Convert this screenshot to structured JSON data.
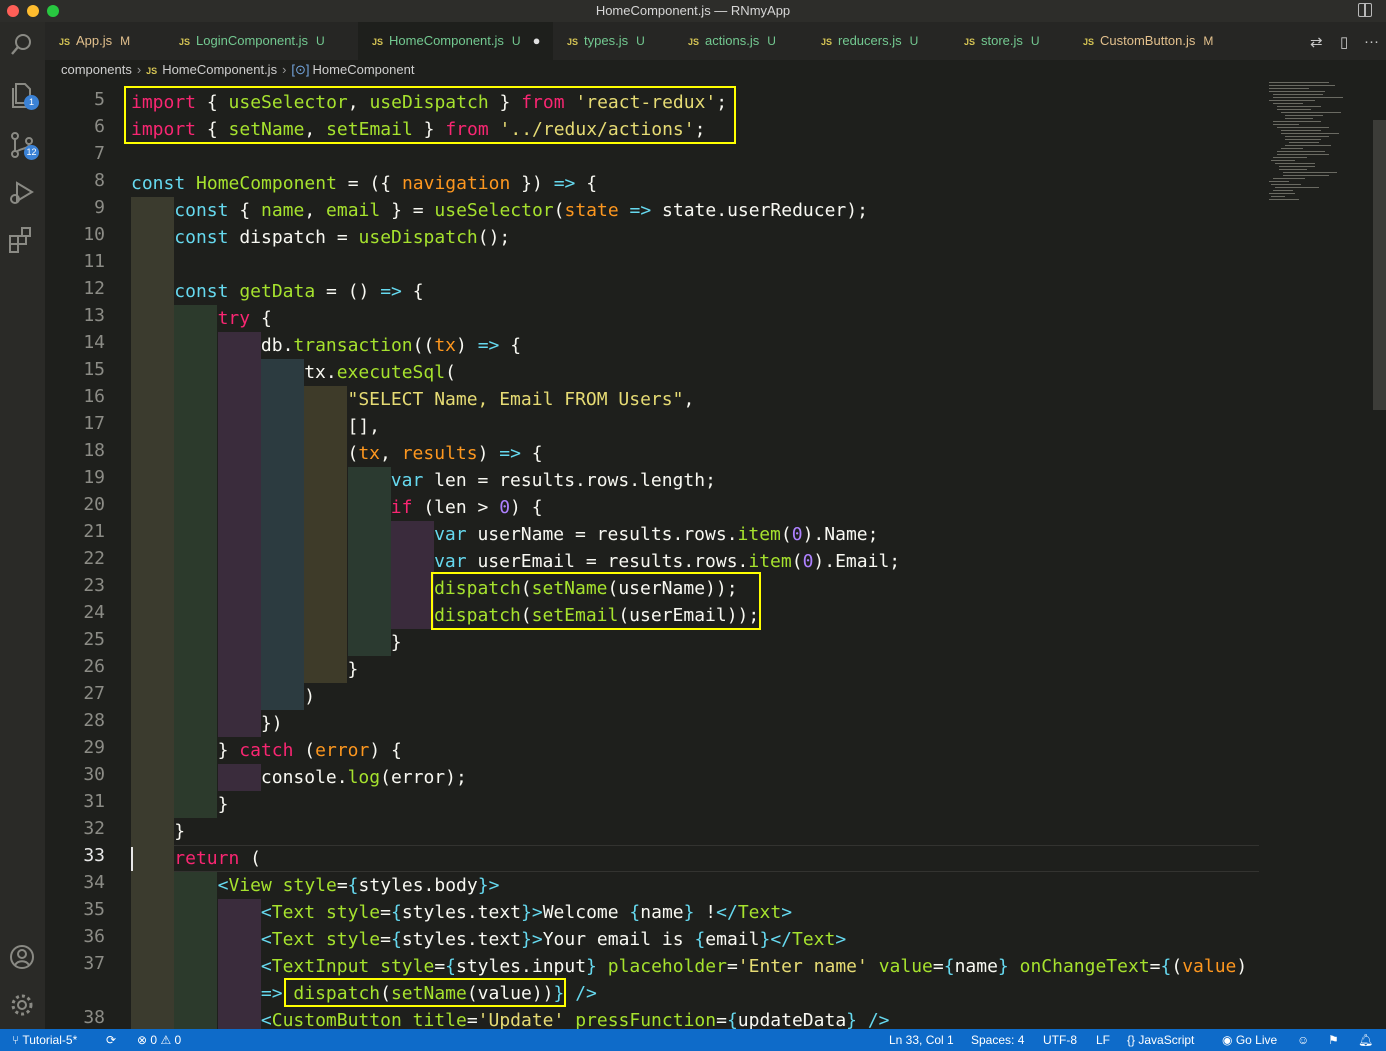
{
  "window": {
    "title": "HomeComponent.js — RNmyApp"
  },
  "activity_bar": {
    "explorer_badge": "1",
    "source_control_badge": "12"
  },
  "tabs": [
    {
      "name": "App.js",
      "status": "M",
      "status_color": "#e2c08d"
    },
    {
      "name": "LoginComponent.js",
      "status": "U",
      "status_color": "#73c991"
    },
    {
      "name": "HomeComponent.js",
      "status": "U",
      "status_color": "#73c991",
      "active": true,
      "dirty": "●"
    },
    {
      "name": "types.js",
      "status": "U",
      "status_color": "#73c991"
    },
    {
      "name": "actions.js",
      "status": "U",
      "status_color": "#73c991"
    },
    {
      "name": "reducers.js",
      "status": "U",
      "status_color": "#73c991"
    },
    {
      "name": "store.js",
      "status": "U",
      "status_color": "#73c991"
    },
    {
      "name": "CustomButton.js",
      "status": "M",
      "status_color": "#e2c08d"
    }
  ],
  "tab_labels": {
    "js": "JS",
    "more": "···"
  },
  "breadcrumb": {
    "folder": "components",
    "file": "HomeComponent.js",
    "symbol": "HomeComponent"
  },
  "editor": {
    "current_line": "33",
    "lines": [
      {
        "no": "5",
        "depth": 0
      },
      {
        "no": "6",
        "depth": 0
      },
      {
        "no": "7",
        "depth": 0
      },
      {
        "no": "8",
        "depth": 0
      },
      {
        "no": "9",
        "depth": 1
      },
      {
        "no": "10",
        "depth": 1
      },
      {
        "no": "11",
        "depth": 1
      },
      {
        "no": "12",
        "depth": 1
      },
      {
        "no": "13",
        "depth": 2
      },
      {
        "no": "14",
        "depth": 3
      },
      {
        "no": "15",
        "depth": 4
      },
      {
        "no": "16",
        "depth": 5
      },
      {
        "no": "17",
        "depth": 5
      },
      {
        "no": "18",
        "depth": 5
      },
      {
        "no": "19",
        "depth": 6
      },
      {
        "no": "20",
        "depth": 6
      },
      {
        "no": "21",
        "depth": 7
      },
      {
        "no": "22",
        "depth": 7
      },
      {
        "no": "23",
        "depth": 7
      },
      {
        "no": "24",
        "depth": 7
      },
      {
        "no": "25",
        "depth": 6
      },
      {
        "no": "26",
        "depth": 5
      },
      {
        "no": "27",
        "depth": 4
      },
      {
        "no": "28",
        "depth": 3
      },
      {
        "no": "29",
        "depth": 2
      },
      {
        "no": "30",
        "depth": 3
      },
      {
        "no": "31",
        "depth": 2
      },
      {
        "no": "32",
        "depth": 1
      },
      {
        "no": "33",
        "depth": 1
      },
      {
        "no": "34",
        "depth": 2
      },
      {
        "no": "35",
        "depth": 3
      },
      {
        "no": "36",
        "depth": 3
      },
      {
        "no": "37",
        "depth": 3
      },
      {
        "no": "",
        "depth": 3
      },
      {
        "no": "38",
        "depth": 3
      }
    ],
    "code": [
      [
        [
          "p",
          "import"
        ],
        [
          "w",
          " { "
        ],
        [
          "f",
          "useSelector"
        ],
        [
          "w",
          ", "
        ],
        [
          "f",
          "useDispatch"
        ],
        [
          "w",
          " } "
        ],
        [
          "p",
          "from"
        ],
        [
          "w",
          " "
        ],
        [
          "s",
          "'react-redux'"
        ],
        [
          "w",
          ";"
        ]
      ],
      [
        [
          "p",
          "import"
        ],
        [
          "w",
          " { "
        ],
        [
          "f",
          "setName"
        ],
        [
          "w",
          ", "
        ],
        [
          "f",
          "setEmail"
        ],
        [
          "w",
          " } "
        ],
        [
          "p",
          "from"
        ],
        [
          "w",
          " "
        ],
        [
          "s",
          "'../redux/actions'"
        ],
        [
          "w",
          ";"
        ]
      ],
      [],
      [
        [
          "k",
          "const"
        ],
        [
          "w",
          " "
        ],
        [
          "f",
          "HomeComponent"
        ],
        [
          "w",
          " = ({ "
        ],
        [
          "v",
          "navigation"
        ],
        [
          "w",
          " }) "
        ],
        [
          "k",
          "=>"
        ],
        [
          "w",
          " {"
        ]
      ],
      [
        [
          "k",
          "const"
        ],
        [
          "w",
          " { "
        ],
        [
          "f",
          "name"
        ],
        [
          "w",
          ", "
        ],
        [
          "f",
          "email"
        ],
        [
          "w",
          " } = "
        ],
        [
          "f",
          "useSelector"
        ],
        [
          "w",
          "("
        ],
        [
          "v",
          "state"
        ],
        [
          "w",
          " "
        ],
        [
          "k",
          "=>"
        ],
        [
          "w",
          " state."
        ],
        [
          "w",
          "userReducer"
        ],
        [
          "w",
          ");"
        ]
      ],
      [
        [
          "k",
          "const"
        ],
        [
          "w",
          " dispatch = "
        ],
        [
          "f",
          "useDispatch"
        ],
        [
          "w",
          "();"
        ]
      ],
      [],
      [
        [
          "k",
          "const"
        ],
        [
          "w",
          " "
        ],
        [
          "f",
          "getData"
        ],
        [
          "w",
          " = () "
        ],
        [
          "k",
          "=>"
        ],
        [
          "w",
          " {"
        ]
      ],
      [
        [
          "p",
          "try"
        ],
        [
          "w",
          " {"
        ]
      ],
      [
        [
          "w",
          "db."
        ],
        [
          "f",
          "transaction"
        ],
        [
          "w",
          "(("
        ],
        [
          "v",
          "tx"
        ],
        [
          "w",
          ") "
        ],
        [
          "k",
          "=>"
        ],
        [
          "w",
          " {"
        ]
      ],
      [
        [
          "w",
          "tx."
        ],
        [
          "f",
          "executeSql"
        ],
        [
          "w",
          "("
        ]
      ],
      [
        [
          "s",
          "\"SELECT Name, Email FROM Users\""
        ],
        [
          "w",
          ","
        ]
      ],
      [
        [
          "w",
          "[],"
        ]
      ],
      [
        [
          "w",
          "("
        ],
        [
          "v",
          "tx"
        ],
        [
          "w",
          ", "
        ],
        [
          "v",
          "results"
        ],
        [
          "w",
          ") "
        ],
        [
          "k",
          "=>"
        ],
        [
          "w",
          " {"
        ]
      ],
      [
        [
          "k",
          "var"
        ],
        [
          "w",
          " len = results.rows.length;"
        ]
      ],
      [
        [
          "p",
          "if"
        ],
        [
          "w",
          " (len > "
        ],
        [
          "o",
          "0"
        ],
        [
          "w",
          ") {"
        ]
      ],
      [
        [
          "k",
          "var"
        ],
        [
          "w",
          " userName = results.rows."
        ],
        [
          "f",
          "item"
        ],
        [
          "w",
          "("
        ],
        [
          "o",
          "0"
        ],
        [
          "w",
          ").Name;"
        ]
      ],
      [
        [
          "k",
          "var"
        ],
        [
          "w",
          " userEmail = results.rows."
        ],
        [
          "f",
          "item"
        ],
        [
          "w",
          "("
        ],
        [
          "o",
          "0"
        ],
        [
          "w",
          ").Email;"
        ]
      ],
      [
        [
          "f",
          "dispatch"
        ],
        [
          "w",
          "("
        ],
        [
          "f",
          "setName"
        ],
        [
          "w",
          "(userName));"
        ]
      ],
      [
        [
          "f",
          "dispatch"
        ],
        [
          "w",
          "("
        ],
        [
          "f",
          "setEmail"
        ],
        [
          "w",
          "(userEmail));"
        ]
      ],
      [
        [
          "w",
          "}"
        ]
      ],
      [
        [
          "w",
          "}"
        ]
      ],
      [
        [
          "w",
          ")"
        ]
      ],
      [
        [
          "w",
          "})"
        ]
      ],
      [
        [
          "w",
          "} "
        ],
        [
          "p",
          "catch"
        ],
        [
          "w",
          " ("
        ],
        [
          "v",
          "error"
        ],
        [
          "w",
          ") {"
        ]
      ],
      [
        [
          "w",
          "console."
        ],
        [
          "f",
          "log"
        ],
        [
          "w",
          "(error);"
        ]
      ],
      [
        [
          "w",
          "}"
        ]
      ],
      [
        [
          "w",
          "}"
        ]
      ],
      [
        [
          "p",
          "return"
        ],
        [
          "w",
          " ("
        ]
      ],
      [
        [
          "k",
          "<"
        ],
        [
          "f",
          "View"
        ],
        [
          "w",
          " "
        ],
        [
          "f",
          "style"
        ],
        [
          "w",
          "="
        ],
        [
          "k",
          "{"
        ],
        [
          "w",
          "styles.body"
        ],
        [
          "k",
          "}"
        ],
        [
          "k",
          ">"
        ]
      ],
      [
        [
          "k",
          "<"
        ],
        [
          "f",
          "Text"
        ],
        [
          "w",
          " "
        ],
        [
          "f",
          "style"
        ],
        [
          "w",
          "="
        ],
        [
          "k",
          "{"
        ],
        [
          "w",
          "styles.text"
        ],
        [
          "k",
          "}"
        ],
        [
          "k",
          ">"
        ],
        [
          "w",
          "Welcome "
        ],
        [
          "k",
          "{"
        ],
        [
          "w",
          "name"
        ],
        [
          "k",
          "}"
        ],
        [
          "w",
          " !"
        ],
        [
          "k",
          "</"
        ],
        [
          "f",
          "Text"
        ],
        [
          "k",
          ">"
        ]
      ],
      [
        [
          "k",
          "<"
        ],
        [
          "f",
          "Text"
        ],
        [
          "w",
          " "
        ],
        [
          "f",
          "style"
        ],
        [
          "w",
          "="
        ],
        [
          "k",
          "{"
        ],
        [
          "w",
          "styles.text"
        ],
        [
          "k",
          "}"
        ],
        [
          "k",
          ">"
        ],
        [
          "w",
          "Your email is "
        ],
        [
          "k",
          "{"
        ],
        [
          "w",
          "email"
        ],
        [
          "k",
          "}"
        ],
        [
          "k",
          "</"
        ],
        [
          "f",
          "Text"
        ],
        [
          "k",
          ">"
        ]
      ],
      [
        [
          "k",
          "<"
        ],
        [
          "f",
          "TextInput"
        ],
        [
          "w",
          " "
        ],
        [
          "f",
          "style"
        ],
        [
          "w",
          "="
        ],
        [
          "k",
          "{"
        ],
        [
          "w",
          "styles.input"
        ],
        [
          "k",
          "}"
        ],
        [
          "w",
          " "
        ],
        [
          "f",
          "placeholder"
        ],
        [
          "w",
          "="
        ],
        [
          "s",
          "'Enter name'"
        ],
        [
          "w",
          " "
        ],
        [
          "f",
          "value"
        ],
        [
          "w",
          "="
        ],
        [
          "k",
          "{"
        ],
        [
          "w",
          "name"
        ],
        [
          "k",
          "}"
        ],
        [
          "w",
          " "
        ],
        [
          "f",
          "onChangeText"
        ],
        [
          "w",
          "="
        ],
        [
          "k",
          "{"
        ],
        [
          "w",
          "("
        ],
        [
          "v",
          "value"
        ],
        [
          "w",
          ")"
        ]
      ],
      [
        [
          "k",
          "=>"
        ],
        [
          "w",
          " "
        ],
        [
          "f",
          "dispatch"
        ],
        [
          "w",
          "("
        ],
        [
          "f",
          "setName"
        ],
        [
          "w",
          "(value))"
        ],
        [
          "k",
          "}"
        ],
        [
          "w",
          " "
        ],
        [
          "k",
          "/>"
        ]
      ],
      [
        [
          "k",
          "<"
        ],
        [
          "f",
          "CustomButton"
        ],
        [
          "w",
          " "
        ],
        [
          "f",
          "title"
        ],
        [
          "w",
          "="
        ],
        [
          "s",
          "'Update'"
        ],
        [
          "w",
          " "
        ],
        [
          "f",
          "pressFunction"
        ],
        [
          "w",
          "="
        ],
        [
          "k",
          "{"
        ],
        [
          "w",
          "updateData"
        ],
        [
          "k",
          "}"
        ],
        [
          "w",
          " "
        ],
        [
          "k",
          "/>"
        ]
      ]
    ],
    "highlight_color": "#ffff00"
  },
  "status_bar": {
    "branch": "Tutorial-5*",
    "errors": "0",
    "warnings": "0",
    "cursor_position": "Ln 33, Col 1",
    "spaces": "Spaces: 4",
    "encoding": "UTF-8",
    "eol": "LF",
    "language": "JavaScript",
    "go_live": "Go Live"
  },
  "colors": {
    "status_bar": "#0e6bc9",
    "editor_bg": "#1e1f1c"
  }
}
